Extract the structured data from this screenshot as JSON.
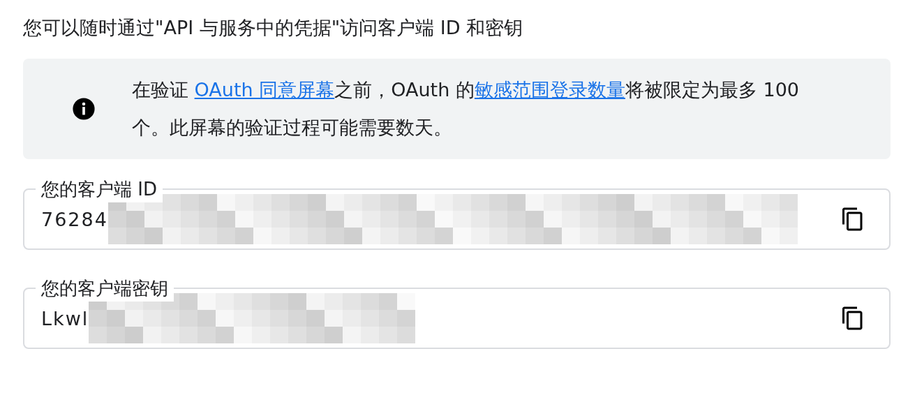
{
  "intro": "您可以随时通过\"API 与服务中的凭据\"访问客户端 ID 和密钥",
  "notice": {
    "parts": [
      {
        "kind": "text",
        "text": "在验证 "
      },
      {
        "kind": "link",
        "text": "OAuth 同意屏幕"
      },
      {
        "kind": "text",
        "text": "之前，OAuth 的"
      },
      {
        "kind": "link",
        "text": "敏感范围登录数量"
      },
      {
        "kind": "text",
        "text": "将被限定为最多 100 个。此屏幕的验证过程可能需要数天。"
      }
    ]
  },
  "fields": [
    {
      "label": "您的客户端 ID",
      "value": "76284",
      "redacted": true
    },
    {
      "label": "您的客户端密钥",
      "value": "Lkwl",
      "redacted": true
    }
  ]
}
